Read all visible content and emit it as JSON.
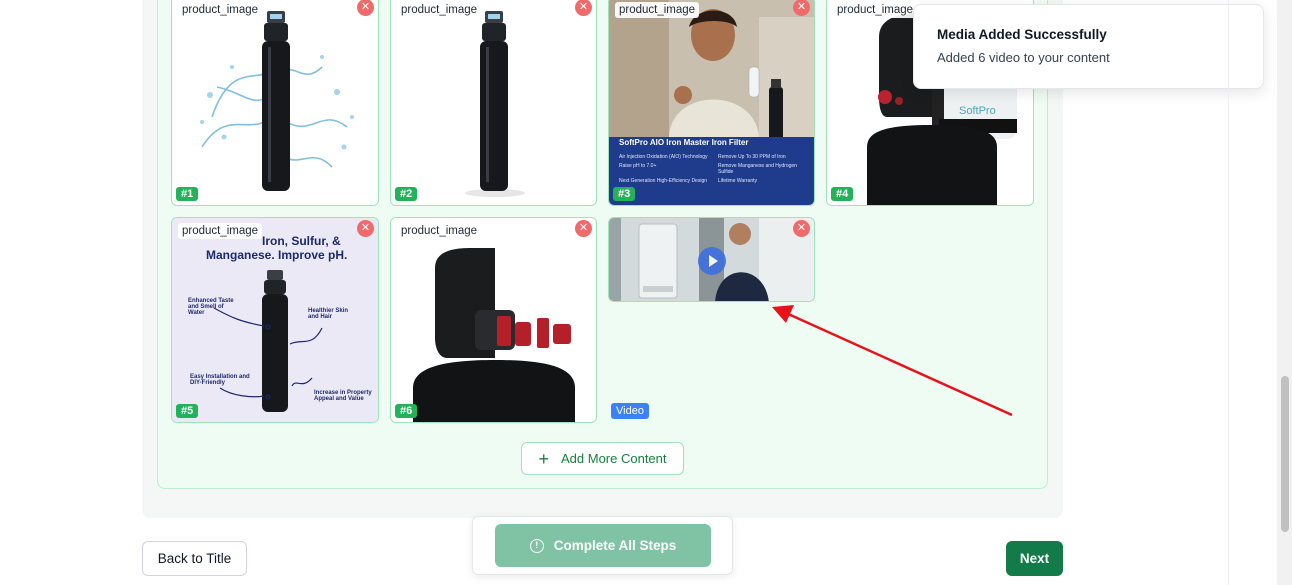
{
  "media": {
    "items": [
      {
        "label": "product_image",
        "number": "#1",
        "remove": "✕"
      },
      {
        "label": "product_image",
        "number": "#2",
        "remove": "✕"
      },
      {
        "label": "product_image",
        "number": "#3",
        "remove": "✕",
        "banner_title": "SoftPro AIO Iron Master Iron Filter",
        "banner_lines": [
          "Air Injection Oxidation (AIO) Technology",
          "Remove Up To 30 PPM of Iron",
          "Raise pH to 7.0+",
          "Remove Manganese and Hydrogen Sulfide",
          "Next Generation High-Efficiency Design",
          "Lifetime Warranty"
        ]
      },
      {
        "label": "product_image",
        "number": "#4",
        "remove": "✕",
        "brand": "SoftPro"
      },
      {
        "label": "product_image",
        "number": "#5",
        "remove": "✕",
        "headline_1": "Iron, Sulfur, &",
        "headline_2": "Manganese. Improve pH.",
        "callouts": [
          "Enhanced Taste and Smell of Water",
          "Healthier Skin and Hair",
          "Easy Installation and DIY-Friendly",
          "Increase in Property Appeal and Value"
        ]
      },
      {
        "label": "product_image",
        "number": "#6",
        "remove": "✕"
      }
    ],
    "video": {
      "badge": "Video",
      "remove": "✕"
    },
    "add_more_label": "Add More Content",
    "add_more_icon": "plus-icon"
  },
  "footer": {
    "back_label": "Back to Title",
    "complete_label": "Complete All Steps",
    "complete_icon": "info-icon",
    "next_label": "Next"
  },
  "toast": {
    "title": "Media Added Successfully",
    "description": "Added 6 video to your content"
  },
  "colors": {
    "accent_green": "#137a4a",
    "badge_green": "#22b35a",
    "remove_red": "#ef6b6b",
    "video_blue": "#3b82f6",
    "arrow_red": "#e8121b"
  }
}
